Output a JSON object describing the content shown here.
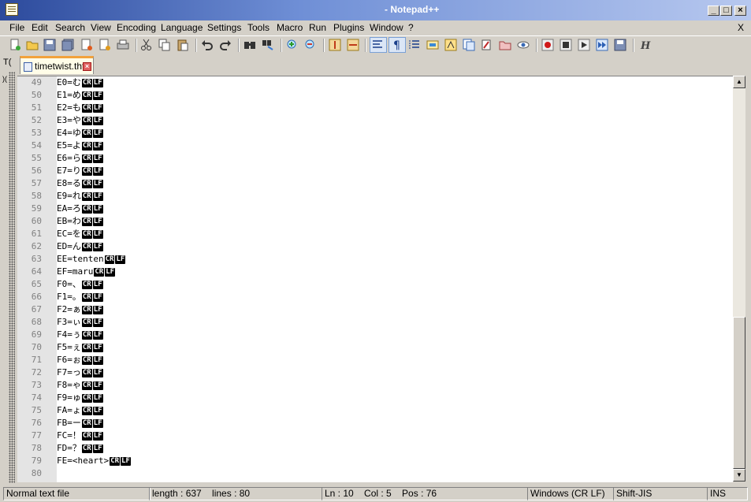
{
  "window": {
    "title": "- Notepad++"
  },
  "menu": [
    "File",
    "Edit",
    "Search",
    "View",
    "Encoding",
    "Language",
    "Settings",
    "Tools",
    "Macro",
    "Run",
    "Plugins",
    "Window",
    "?"
  ],
  "menu_close": "X",
  "side_panel": {
    "letter": "T("
  },
  "tab": {
    "label": "timetwist.tht",
    "active": true
  },
  "eol_markers": {
    "cr": "CR",
    "lf": "LF"
  },
  "editor": {
    "lines": [
      {
        "n": "49",
        "text": "E0=む"
      },
      {
        "n": "50",
        "text": "E1=め"
      },
      {
        "n": "51",
        "text": "E2=も"
      },
      {
        "n": "52",
        "text": "E3=や"
      },
      {
        "n": "53",
        "text": "E4=ゆ"
      },
      {
        "n": "54",
        "text": "E5=よ"
      },
      {
        "n": "55",
        "text": "E6=ら"
      },
      {
        "n": "56",
        "text": "E7=り"
      },
      {
        "n": "57",
        "text": "E8=る"
      },
      {
        "n": "58",
        "text": "E9=れ"
      },
      {
        "n": "59",
        "text": "EA=ろ"
      },
      {
        "n": "60",
        "text": "EB=わ"
      },
      {
        "n": "61",
        "text": "EC=を"
      },
      {
        "n": "62",
        "text": "ED=ん"
      },
      {
        "n": "63",
        "text": "EE=tenten"
      },
      {
        "n": "64",
        "text": "EF=maru"
      },
      {
        "n": "65",
        "text": "F0=、"
      },
      {
        "n": "66",
        "text": "F1=。"
      },
      {
        "n": "67",
        "text": "F2=ぁ"
      },
      {
        "n": "68",
        "text": "F3=ぃ"
      },
      {
        "n": "69",
        "text": "F4=ぅ"
      },
      {
        "n": "70",
        "text": "F5=ぇ"
      },
      {
        "n": "71",
        "text": "F6=ぉ"
      },
      {
        "n": "72",
        "text": "F7=っ"
      },
      {
        "n": "73",
        "text": "F8=ゃ"
      },
      {
        "n": "74",
        "text": "F9=ゅ"
      },
      {
        "n": "75",
        "text": "FA=ょ"
      },
      {
        "n": "76",
        "text": "FB=ー"
      },
      {
        "n": "77",
        "text": "FC=！"
      },
      {
        "n": "78",
        "text": "FD=？"
      },
      {
        "n": "79",
        "text": "FE=<heart>"
      },
      {
        "n": "80",
        "text": "",
        "last": true
      }
    ]
  },
  "statusbar": {
    "type": "Normal text file",
    "length_lines": "length : 637    lines : 80",
    "position": "Ln : 10    Col : 5    Pos : 76",
    "eol": "Windows (CR LF)",
    "encoding": "Shift-JIS",
    "mode": "INS"
  },
  "colors": {
    "titlebar": "#2c4a9c",
    "gutter": "#e4e4e4",
    "line_number": "#808080",
    "tab_accent": "#f2a23c",
    "eol_marker": "#000000"
  }
}
